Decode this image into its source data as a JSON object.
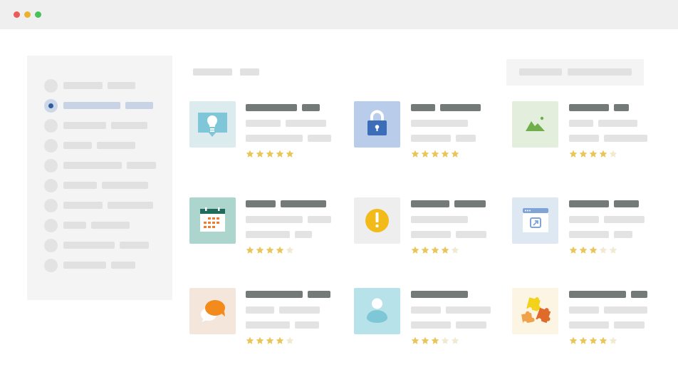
{
  "window": {
    "controls": [
      "close",
      "minimize",
      "maximize"
    ],
    "colors": {
      "close": "#ec5b57",
      "minimize": "#e9b331",
      "maximize": "#47c15a"
    }
  },
  "sidebar": {
    "items": [
      {
        "name": "nav-item-1",
        "selected": false
      },
      {
        "name": "nav-item-2",
        "selected": true
      },
      {
        "name": "nav-item-3",
        "selected": false
      },
      {
        "name": "nav-item-4",
        "selected": false
      },
      {
        "name": "nav-item-5",
        "selected": false
      },
      {
        "name": "nav-item-6",
        "selected": false
      },
      {
        "name": "nav-item-7",
        "selected": false
      },
      {
        "name": "nav-item-8",
        "selected": false
      },
      {
        "name": "nav-item-9",
        "selected": false
      },
      {
        "name": "nav-item-10",
        "selected": false
      }
    ],
    "accent": "#2f5d9e"
  },
  "cards": [
    {
      "icon": "lightbulb-icon",
      "rating": 5,
      "bg": "#dcebee"
    },
    {
      "icon": "lock-icon",
      "rating": 5,
      "bg": "#b9cdeb"
    },
    {
      "icon": "landscape-image-icon",
      "rating": 4,
      "bg": "#e3efdc"
    },
    {
      "icon": "calendar-icon",
      "rating": 4,
      "bg": "#acd6cd"
    },
    {
      "icon": "warning-icon",
      "rating": 4,
      "bg": "#eeeeee"
    },
    {
      "icon": "browser-window-icon",
      "rating": 3,
      "bg": "#dde8f2"
    },
    {
      "icon": "chat-bubbles-icon",
      "rating": 4,
      "bg": "#f5e6dc"
    },
    {
      "icon": "user-icon",
      "rating": 3,
      "bg": "#b8e2ea"
    },
    {
      "icon": "puzzle-pieces-icon",
      "rating": 4,
      "bg": "#fdf5e3"
    }
  ],
  "rating_max": 5,
  "star_colors": {
    "filled": "#e8c65a",
    "empty": "#f1ead0"
  }
}
